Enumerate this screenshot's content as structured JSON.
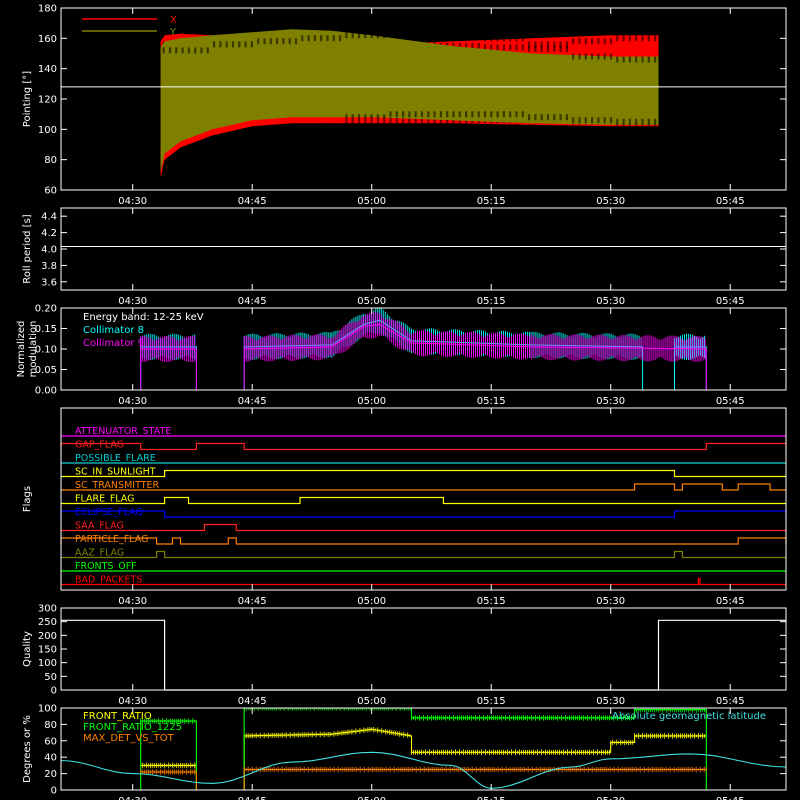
{
  "chart_data": [
    {
      "type": "area",
      "ylabel": "Pointing [°]",
      "ylim": [
        60,
        180
      ],
      "yticks": [
        "60",
        "80",
        "100",
        "120",
        "140",
        "160",
        "180"
      ],
      "xticks": [
        "04:30",
        "04:45",
        "05:00",
        "05:15",
        "05:30",
        "05:45"
      ],
      "xlim": [
        "04:21",
        "05:52"
      ],
      "reference_line": 128,
      "series": [
        {
          "name": "X",
          "color": "#ff0000",
          "x": [
            "04:33:30",
            "04:34",
            "04:36",
            "04:40",
            "04:45",
            "04:50",
            "04:55",
            "05:00",
            "05:10",
            "05:20",
            "05:30",
            "05:36"
          ],
          "low": [
            68,
            80,
            88,
            96,
            102,
            104,
            104,
            104,
            104,
            103,
            102,
            102
          ],
          "high": [
            158,
            162,
            163,
            162,
            160,
            158,
            157,
            156,
            158,
            160,
            162,
            162
          ]
        },
        {
          "name": "Y",
          "color": "#808000",
          "x": [
            "04:33:30",
            "04:34",
            "04:36",
            "04:40",
            "04:45",
            "04:50",
            "04:55",
            "05:00",
            "05:10",
            "05:20",
            "05:30",
            "05:36"
          ],
          "low": [
            72,
            84,
            92,
            100,
            106,
            108,
            108,
            108,
            106,
            104,
            103,
            103
          ],
          "high": [
            154,
            158,
            160,
            162,
            164,
            166,
            165,
            162,
            155,
            150,
            148,
            148
          ]
        }
      ]
    },
    {
      "type": "line",
      "ylabel": "Roll period [s]",
      "ylim": [
        3.5,
        4.5
      ],
      "yticks": [
        "3.6",
        "3.8",
        "4.0",
        "4.2",
        "4.4"
      ],
      "xticks": [
        "04:30",
        "04:45",
        "05:00",
        "05:15",
        "05:30",
        "05:45"
      ],
      "series": [
        {
          "name": "",
          "color": "#ffffff",
          "x": [
            "04:21",
            "05:52"
          ],
          "y": [
            4.03,
            4.03
          ]
        }
      ]
    },
    {
      "type": "line",
      "ylabel": "Normalized modulation",
      "ylim": [
        0,
        0.2
      ],
      "yticks": [
        "0.00",
        "0.05",
        "0.10",
        "0.15",
        "0.20"
      ],
      "xticks": [
        "04:30",
        "04:45",
        "05:00",
        "05:15",
        "05:30",
        "05:45"
      ],
      "legend": [
        "Energy band: 12-25 keV",
        "Collimator 8",
        "Collimator 9"
      ],
      "series": [
        {
          "name": "Collimator 8",
          "color": "#00ffff",
          "x": [
            "04:21",
            "04:31",
            "04:31",
            "04:38",
            "04:38",
            "04:44",
            "04:44",
            "04:55",
            "04:59",
            "05:01",
            "05:05",
            "05:20",
            "05:34",
            "05:34",
            "05:38",
            "05:38",
            "05:42",
            "05:42",
            "05:52"
          ],
          "y": [
            0,
            0,
            0.105,
            0.105,
            0,
            0,
            0.105,
            0.11,
            0.16,
            0.17,
            0.12,
            0.11,
            0.105,
            0,
            0,
            0.105,
            0.105,
            0,
            0
          ]
        },
        {
          "name": "Collimator 9",
          "color": "#ff00ff",
          "x": [
            "04:21",
            "04:31",
            "04:31",
            "04:38",
            "04:38",
            "04:44",
            "04:44",
            "04:55",
            "04:59",
            "05:01",
            "05:05",
            "05:20",
            "05:42",
            "05:42",
            "05:52"
          ],
          "y": [
            0,
            0,
            0.1,
            0.1,
            0,
            0,
            0.1,
            0.105,
            0.155,
            0.16,
            0.115,
            0.105,
            0.1,
            0,
            0
          ]
        }
      ]
    },
    {
      "type": "line",
      "ylabel": "Flags",
      "xticks": [
        "04:30",
        "04:45",
        "05:00",
        "05:15",
        "05:30",
        "05:45"
      ],
      "flags": [
        {
          "name": "ATTENUATOR_STATE",
          "color": "#ff00ff",
          "segments": []
        },
        {
          "name": "GAP_FLAG",
          "color": "#ff2020",
          "segments": [
            [
              "04:21",
              "04:31"
            ],
            [
              "04:38",
              "04:44"
            ],
            [
              "05:42",
              "05:52"
            ]
          ]
        },
        {
          "name": "POSSIBLE_FLARE",
          "color": "#00d0d0",
          "segments": []
        },
        {
          "name": "SC_IN_SUNLIGHT",
          "color": "#ffff00",
          "segments": [
            [
              "04:34",
              "05:38"
            ]
          ]
        },
        {
          "name": "SC_TRANSMITTER",
          "color": "#ff8000",
          "segments": [
            [
              "05:33",
              "05:38"
            ],
            [
              "05:39",
              "05:44"
            ],
            [
              "05:46",
              "05:50"
            ]
          ]
        },
        {
          "name": "FLARE_FLAG",
          "color": "#ffff00",
          "segments": [
            [
              "04:34",
              "04:37"
            ],
            [
              "04:51",
              "05:09"
            ]
          ]
        },
        {
          "name": "ECLIPSE_FLAG",
          "color": "#0000ff",
          "segments": [
            [
              "04:21",
              "04:34"
            ],
            [
              "05:38",
              "05:52"
            ]
          ]
        },
        {
          "name": "SAA_FLAG",
          "color": "#ff2020",
          "segments": [
            [
              "04:39",
              "04:43"
            ]
          ]
        },
        {
          "name": "PARTICLE_FLAG",
          "color": "#ff8000",
          "segments": [
            [
              "04:21",
              "04:33"
            ],
            [
              "04:35",
              "04:36"
            ],
            [
              "04:42",
              "04:43"
            ],
            [
              "05:46",
              "05:52"
            ]
          ]
        },
        {
          "name": "AAZ_FLAG",
          "color": "#808000",
          "segments": [
            [
              "04:33",
              "04:34"
            ],
            [
              "05:38",
              "05:39"
            ]
          ]
        },
        {
          "name": "FRONTS_OFF",
          "color": "#00ff00",
          "segments": []
        },
        {
          "name": "BAD_PACKETS",
          "color": "#ff0000",
          "segments": [
            [
              "05:41",
              "05:41"
            ]
          ]
        }
      ]
    },
    {
      "type": "line",
      "ylabel": "Quality",
      "ylim": [
        0,
        300
      ],
      "yticks": [
        "0",
        "50",
        "100",
        "150",
        "200",
        "250",
        "300"
      ],
      "xticks": [
        "04:30",
        "04:45",
        "05:00",
        "05:15",
        "05:30",
        "05:45"
      ],
      "series": [
        {
          "name": "",
          "color": "#ffffff",
          "x": [
            "04:21",
            "04:34",
            "04:34",
            "05:36",
            "05:36",
            "05:52"
          ],
          "y": [
            255,
            255,
            0,
            0,
            255,
            255
          ]
        }
      ]
    },
    {
      "type": "line",
      "ylabel": "Degrees or %",
      "ylim": [
        0,
        100
      ],
      "yticks": [
        "0",
        "20",
        "40",
        "60",
        "80",
        "100"
      ],
      "xticks": [
        "04:30",
        "04:45",
        "05:00",
        "05:15",
        "05:30",
        "05:45"
      ],
      "legend_right": "Absolute geomagnetic latitude",
      "series": [
        {
          "name": "FRONT_RATIO",
          "color": "#ffff00",
          "x": [
            "04:31",
            "04:38",
            "04:38",
            "04:44",
            "04:44",
            "04:55",
            "05:00",
            "05:05",
            "05:05",
            "05:30",
            "05:30",
            "05:33",
            "05:33",
            "05:42"
          ],
          "y": [
            30,
            30,
            0,
            0,
            66,
            68,
            74,
            66,
            46,
            46,
            58,
            58,
            66,
            66
          ]
        },
        {
          "name": "FRONT_RATIO_1225",
          "color": "#00ff00",
          "x": [
            "04:21",
            "04:31",
            "04:31",
            "04:38",
            "04:38",
            "04:44",
            "04:44",
            "05:05",
            "05:05",
            "05:33",
            "05:33",
            "05:42",
            "05:42",
            "05:52"
          ],
          "y": [
            0,
            0,
            84,
            84,
            0,
            0,
            100,
            100,
            88,
            88,
            98,
            98,
            0,
            0
          ]
        },
        {
          "name": "MAX_DET_VS_TOT",
          "color": "#ff8000",
          "x": [
            "04:31",
            "04:38",
            "04:38",
            "04:44",
            "04:44",
            "05:42"
          ],
          "y": [
            22,
            22,
            0,
            0,
            25,
            25
          ]
        },
        {
          "name": "Absolute geomagnetic latitude",
          "color": "#40e0e0",
          "x": [
            "04:21",
            "04:30",
            "04:40",
            "04:50",
            "05:00",
            "05:10",
            "05:15",
            "05:25",
            "05:30",
            "05:40",
            "05:52"
          ],
          "y": [
            36,
            20,
            8,
            34,
            46,
            30,
            2,
            28,
            38,
            44,
            28
          ]
        }
      ]
    }
  ]
}
